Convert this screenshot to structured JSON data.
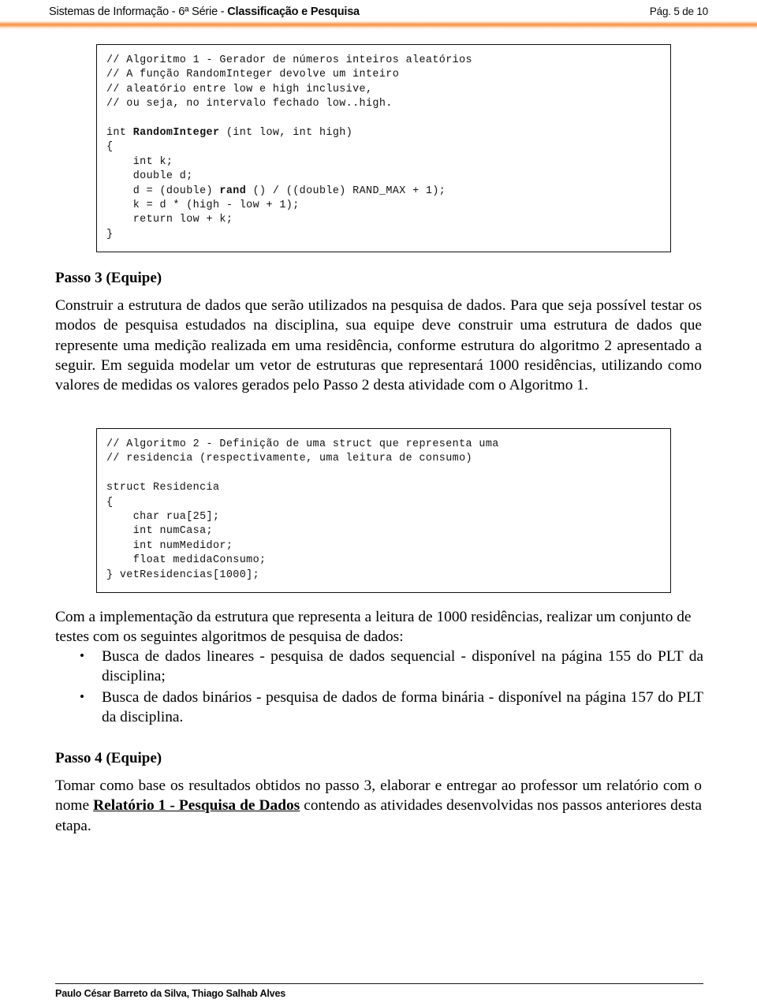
{
  "header": {
    "title_plain": "Sistemas de Informação - 6ª Série - ",
    "title_bold": "Classificação e Pesquisa",
    "page_indicator": "Pág. 5 de 10",
    "rule_color": "#F7964B"
  },
  "code_blocks": [
    {
      "id": "algoritmo-1",
      "lines_before_bold": "// Algoritmo 1 - Gerador de números inteiros aleatórios\n// A função RandomInteger devolve um inteiro\n// aleatório entre low e high inclusive,\n// ou seja, no intervalo fechado low..high.\n\nint ",
      "bold_1": "RandomInteger",
      "mid_1": " (int low, int high)\n{\n    int k;\n    double d;\n    d = (double) ",
      "bold_2": "rand",
      "mid_2": " () / ((double) RAND_MAX + 1);\n    k = d * (high - low + 1);\n    return low + k;\n}"
    },
    {
      "id": "algoritmo-2",
      "text": "// Algoritmo 2 - Definição de uma struct que representa uma\n// residencia (respectivamente, uma leitura de consumo)\n\nstruct Residencia\n{\n    char rua[25];\n    int numCasa;\n    int numMedidor;\n    float medidaConsumo;\n} vetResidencias[1000];"
    }
  ],
  "sections": {
    "passo3": {
      "heading": "Passo 3 (Equipe)",
      "paragraph": "Construir a estrutura de dados que serão utilizados na pesquisa de dados. Para que seja possível testar os modos de pesquisa estudados na disciplina, sua equipe deve construir uma estrutura de dados que represente uma medição realizada em uma residência, conforme estrutura do algoritmo 2 apresentado a seguir. Em seguida modelar um vetor de estruturas que representará 1000 residências, utilizando como valores de medidas os valores gerados pelo Passo 2 desta atividade com o Algoritmo 1."
    },
    "after_struct": {
      "paragraph": "Com a implementação da estrutura que representa a leitura de 1000 residências, realizar um conjunto de testes com os seguintes algoritmos de pesquisa de dados:"
    },
    "algorithm_list": {
      "bullet_glyph": "•",
      "items": [
        "Busca de dados lineares - pesquisa de dados sequencial - disponível na página 155 do PLT da disciplina;",
        "Busca de dados binários - pesquisa de dados de forma binária - disponível na página 157 do PLT da disciplina."
      ]
    },
    "passo4": {
      "heading": "Passo 4 (Equipe)",
      "par_part_1": "Tomar como base os resultados obtidos no passo 3, elaborar e entregar ao professor um relatório com o nome ",
      "par_emphasis": "Relatório 1 - Pesquisa de Dados",
      "par_part_2": " contendo as atividades desenvolvidas nos passos anteriores desta etapa."
    }
  },
  "footer": {
    "authors": "Paulo César Barreto da Silva, Thiago Salhab Alves"
  }
}
